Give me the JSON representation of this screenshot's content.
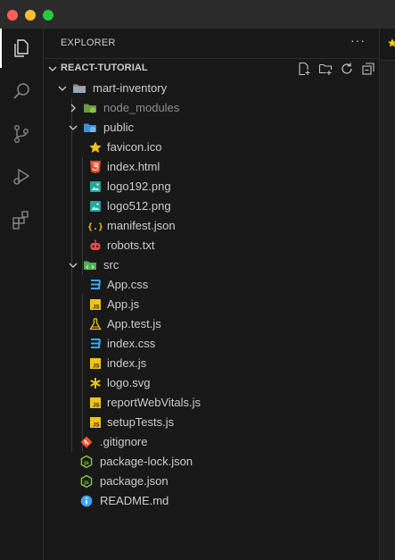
{
  "window": {
    "traffic_lights": [
      "close",
      "minimize",
      "zoom"
    ],
    "colors": {
      "close": "#ff5f57",
      "minimize": "#febc2e",
      "zoom": "#28c840"
    }
  },
  "activity_bar": {
    "items": [
      {
        "name": "explorer-icon",
        "active": true
      },
      {
        "name": "search-icon",
        "active": false
      },
      {
        "name": "source-control-icon",
        "active": false
      },
      {
        "name": "run-debug-icon",
        "active": false
      },
      {
        "name": "extensions-icon",
        "active": false
      }
    ]
  },
  "explorer": {
    "title": "EXPLORER",
    "more_actions": "···",
    "section": {
      "label": "REACT-TUTORIAL",
      "actions": [
        "new-file-icon",
        "new-folder-icon",
        "refresh-icon",
        "collapse-all-icon"
      ]
    },
    "tree": [
      {
        "label": "mart-inventory",
        "type": "folder",
        "expanded": true,
        "depth": 0,
        "icon": "folder-icon"
      },
      {
        "label": "node_modules",
        "type": "folder",
        "expanded": false,
        "depth": 1,
        "icon": "node-folder-icon",
        "dim": true
      },
      {
        "label": "public",
        "type": "folder",
        "expanded": true,
        "depth": 1,
        "icon": "public-folder-icon"
      },
      {
        "label": "favicon.ico",
        "type": "file",
        "depth": 2,
        "icon": "favicon-star-icon"
      },
      {
        "label": "index.html",
        "type": "file",
        "depth": 2,
        "icon": "html5-icon"
      },
      {
        "label": "logo192.png",
        "type": "file",
        "depth": 2,
        "icon": "image-icon"
      },
      {
        "label": "logo512.png",
        "type": "file",
        "depth": 2,
        "icon": "image-icon"
      },
      {
        "label": "manifest.json",
        "type": "file",
        "depth": 2,
        "icon": "json-braces-icon"
      },
      {
        "label": "robots.txt",
        "type": "file",
        "depth": 2,
        "icon": "robot-icon"
      },
      {
        "label": "src",
        "type": "folder",
        "expanded": true,
        "depth": 1,
        "icon": "src-folder-icon"
      },
      {
        "label": "App.css",
        "type": "file",
        "depth": 2,
        "icon": "css3-icon"
      },
      {
        "label": "App.js",
        "type": "file",
        "depth": 2,
        "icon": "javascript-icon"
      },
      {
        "label": "App.test.js",
        "type": "file",
        "depth": 2,
        "icon": "test-flask-icon"
      },
      {
        "label": "index.css",
        "type": "file",
        "depth": 2,
        "icon": "css3-icon"
      },
      {
        "label": "index.js",
        "type": "file",
        "depth": 2,
        "icon": "javascript-icon"
      },
      {
        "label": "logo.svg",
        "type": "file",
        "depth": 2,
        "icon": "svg-asterisk-icon"
      },
      {
        "label": "reportWebVitals.js",
        "type": "file",
        "depth": 2,
        "icon": "javascript-icon"
      },
      {
        "label": "setupTests.js",
        "type": "file",
        "depth": 2,
        "icon": "javascript-icon"
      },
      {
        "label": ".gitignore",
        "type": "file",
        "depth": 1,
        "icon": "git-icon"
      },
      {
        "label": "package-lock.json",
        "type": "file",
        "depth": 1,
        "icon": "nodejs-icon"
      },
      {
        "label": "package.json",
        "type": "file",
        "depth": 1,
        "icon": "nodejs-icon"
      },
      {
        "label": "README.md",
        "type": "file",
        "depth": 1,
        "icon": "info-icon"
      }
    ]
  },
  "editor": {
    "tab_icon": "favicon-star-icon"
  },
  "colors": {
    "background": "#181818",
    "text": "#cccccc",
    "dim_text": "#8c8c8c",
    "folder": "#519aba",
    "star": "#f1c40f",
    "html": "#e44d26",
    "css": "#42a5f5",
    "js": "#f0c419",
    "git": "#f14e32",
    "node": "#8cc84b",
    "info": "#42a5f5",
    "robot": "#e54c4c",
    "image": "#26a69a"
  }
}
